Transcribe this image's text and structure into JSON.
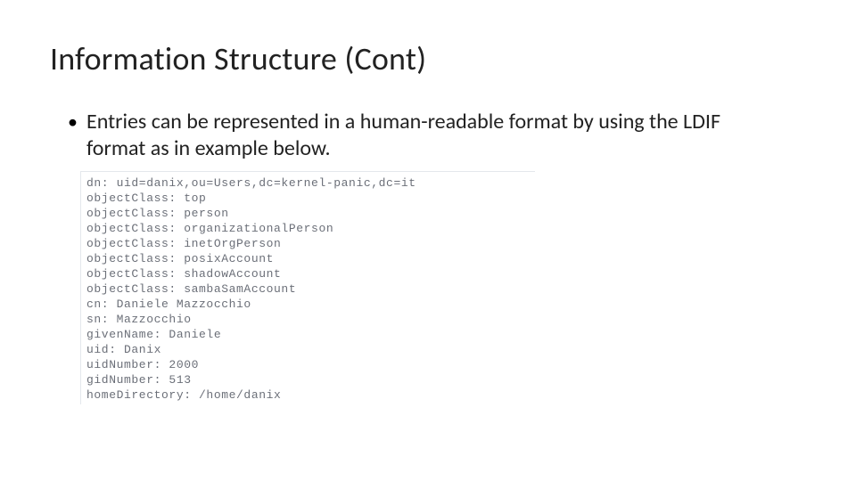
{
  "title": "Information Structure (Cont)",
  "bullet": "Entries can be represented in a human-readable format by using the LDIF format as in example below.",
  "code_lines": [
    "dn: uid=danix,ou=Users,dc=kernel-panic,dc=it",
    "objectClass: top",
    "objectClass: person",
    "objectClass: organizationalPerson",
    "objectClass: inetOrgPerson",
    "objectClass: posixAccount",
    "objectClass: shadowAccount",
    "objectClass: sambaSamAccount",
    "cn: Daniele Mazzocchio",
    "sn: Mazzocchio",
    "givenName: Daniele",
    "uid: Danix",
    "uidNumber: 2000",
    "gidNumber: 513",
    "homeDirectory: /home/danix"
  ]
}
